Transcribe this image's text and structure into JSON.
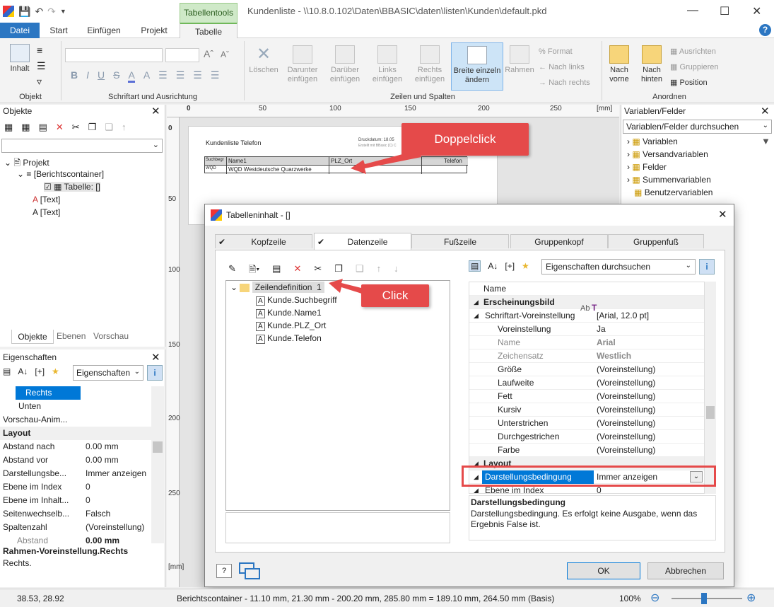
{
  "title": {
    "context_tab": "Tabellentools",
    "window_title": "Kundenliste - \\\\10.8.0.102\\Daten\\BBASIC\\daten\\listen\\Kunden\\default.pkd",
    "help": "?"
  },
  "tabs": [
    "Datei",
    "Start",
    "Einfügen",
    "Projekt",
    "Tabelle"
  ],
  "ribbon": {
    "groups": {
      "objekt": "Objekt",
      "schrift": "Schriftart und Ausrichtung",
      "zeilen": "Zeilen und Spalten",
      "anordnen": "Anordnen"
    },
    "inhalt": "Inhalt",
    "loeschen": "Löschen",
    "darunter": [
      "Darunter",
      "einfügen"
    ],
    "darueber": [
      "Darüber",
      "einfügen"
    ],
    "links": [
      "Links",
      "einfügen"
    ],
    "rechts": [
      "Rechts",
      "einfügen"
    ],
    "breite": [
      "Breite einzeln",
      "ändern"
    ],
    "rahmen": "Rahmen",
    "format": "Format",
    "nach_links": "Nach links",
    "nach_rechts": "Nach rechts",
    "nach_vorne": [
      "Nach",
      "vorne"
    ],
    "nach_hinten": [
      "Nach",
      "hinten"
    ],
    "ausrichten": "Ausrichten",
    "gruppieren": "Gruppieren",
    "position": "Position",
    "fmt_letters": [
      "B",
      "I",
      "U",
      "S",
      "A",
      "A"
    ]
  },
  "objekte": {
    "title": "Objekte",
    "tree": [
      "Projekt",
      "[Berichtscontainer]",
      "Tabelle: []",
      "[Text]",
      "[Text]"
    ],
    "tabs": [
      "Objekte",
      "Ebenen",
      "Vorschau"
    ]
  },
  "eigenschaften": {
    "title": "Eigenschaften",
    "search": "Eigenschaften",
    "rows": [
      {
        "k": "Rechts",
        "v": ""
      },
      {
        "k": "Unten",
        "v": ""
      },
      {
        "k": "Vorschau-Anim...",
        "v": ""
      },
      {
        "k": "Layout",
        "v": ""
      },
      {
        "k": "Abstand nach",
        "v": "0.00 mm"
      },
      {
        "k": "Abstand vor",
        "v": "0.00 mm"
      },
      {
        "k": "Darstellungsbe...",
        "v": "Immer anzeigen"
      },
      {
        "k": "Ebene im Index",
        "v": "0"
      },
      {
        "k": "Ebene im Inhalt...",
        "v": "0"
      },
      {
        "k": "Seitenwechselb...",
        "v": "Falsch"
      },
      {
        "k": "Spaltenzahl",
        "v": "(Voreinstellung)"
      },
      {
        "k": "Abstand",
        "v": "0.00 mm"
      }
    ],
    "desc_title": "Rahmen-Voreinstellung.Rechts",
    "desc_text": "Rechts."
  },
  "variablen": {
    "title": "Variablen/Felder",
    "search": "Variablen/Felder durchsuchen",
    "items": [
      "Variablen",
      "Versandvariablen",
      "Felder",
      "Summenvariablen",
      "Benutzervariablen"
    ]
  },
  "ruler": {
    "h": [
      "0",
      "50",
      "100",
      "150",
      "200",
      "250",
      "[mm]"
    ],
    "v": [
      "0",
      "50",
      "100",
      "150",
      "200",
      "250",
      "[mm]"
    ]
  },
  "canvas": {
    "report_title": "Kundenliste Telefon",
    "druck": "Druckdatum: 18.05",
    "erstellt": "Erstellt mit BBasic (C) C",
    "headers": [
      "Suchbegr",
      "Name1",
      "PLZ_Ort",
      "Telefon"
    ],
    "row": [
      "WQD",
      "WQD Westdeutsche Quarzwerke",
      "",
      ""
    ]
  },
  "callouts": {
    "doppelclick": "Doppelclick",
    "click": "Click"
  },
  "dialog": {
    "title": "Tabelleninhalt - []",
    "tabs": [
      "Kopfzeile",
      "Datenzeile",
      "Fußzeile",
      "Gruppenkopf",
      "Gruppenfuß"
    ],
    "tree": {
      "root": "Zeilendefinition",
      "root_num": "1",
      "children": [
        "Kunde.Suchbegriff",
        "Kunde.Name1",
        "Kunde.PLZ_Ort",
        "Kunde.Telefon"
      ]
    },
    "prop_search": "Eigenschaften durchsuchen",
    "props": [
      {
        "k": "Name",
        "v": "",
        "lvl": 0
      },
      {
        "k": "Erscheinungsbild",
        "v": "",
        "lvl": 0,
        "sec": true
      },
      {
        "k": "Schriftart-Voreinstellung",
        "v": "[Arial, 12.0 pt]",
        "lvl": 1
      },
      {
        "k": "Voreinstellung",
        "v": "Ja",
        "lvl": 2
      },
      {
        "k": "Name",
        "v": "Arial",
        "lvl": 2,
        "dim": true
      },
      {
        "k": "Zeichensatz",
        "v": "Westlich",
        "lvl": 2,
        "dim": true
      },
      {
        "k": "Größe",
        "v": "(Voreinstellung)",
        "lvl": 2
      },
      {
        "k": "Laufweite",
        "v": "(Voreinstellung)",
        "lvl": 2
      },
      {
        "k": "Fett",
        "v": "(Voreinstellung)",
        "lvl": 2
      },
      {
        "k": "Kursiv",
        "v": "(Voreinstellung)",
        "lvl": 2
      },
      {
        "k": "Unterstrichen",
        "v": "(Voreinstellung)",
        "lvl": 2
      },
      {
        "k": "Durchgestrichen",
        "v": "(Voreinstellung)",
        "lvl": 2
      },
      {
        "k": "Farbe",
        "v": "(Voreinstellung)",
        "lvl": 2
      },
      {
        "k": "Layout",
        "v": "",
        "lvl": 0,
        "sec": true
      },
      {
        "k": "Darstellungsbedingung",
        "v": "Immer anzeigen",
        "lvl": 1,
        "sel": true
      },
      {
        "k": "Ebene im Index",
        "v": "0",
        "lvl": 1
      }
    ],
    "ab": "Ab",
    "desc_title": "Darstellungsbedingung",
    "desc_text": "Darstellungsbedingung. Es erfolgt keine Ausgabe, wenn das Ergebnis False ist.",
    "ok": "OK",
    "cancel": "Abbrechen"
  },
  "status": {
    "coords": "38.53, 28.92",
    "info": "Berichtscontainer  -  11.10 mm, 21.30 mm  -  200.20 mm, 285.80 mm  =  189.10 mm, 264.50 mm (Basis)",
    "zoom": "100%"
  }
}
